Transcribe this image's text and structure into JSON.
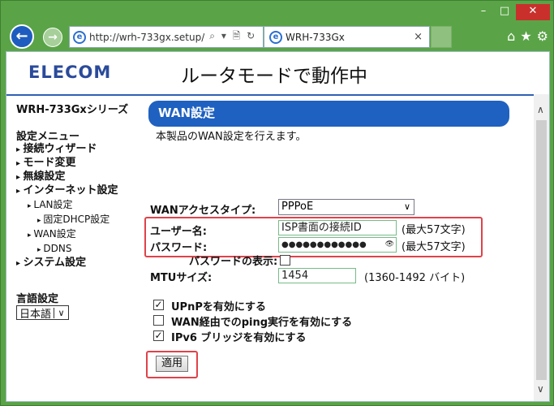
{
  "window": {
    "controls": {
      "minimize": "–",
      "maximize": "□",
      "close": "✕"
    }
  },
  "browser": {
    "url": "http://wrh-733gx.setup/",
    "addr_tools": "⌕ ▾ 🗎 ↻",
    "tab_title": "WRH-733Gx",
    "tab_close": "×",
    "tools": [
      "⌂",
      "★",
      "⚙"
    ]
  },
  "header": {
    "logo": "ELECOM",
    "mode_title": "ルータモードで動作中"
  },
  "sidebar": {
    "series": "WRH-733Gxシリーズ",
    "menu_heading": "設定メニュー",
    "items": [
      {
        "label": "接続ウィザード",
        "level": 1
      },
      {
        "label": "モード変更",
        "level": 1
      },
      {
        "label": "無線設定",
        "level": 1
      },
      {
        "label": "インターネット設定",
        "level": 1
      },
      {
        "label": "LAN設定",
        "level": 2
      },
      {
        "label": "固定DHCP設定",
        "level": 3
      },
      {
        "label": "WAN設定",
        "level": 2
      },
      {
        "label": "DDNS",
        "level": 3
      },
      {
        "label": "システム設定",
        "level": 1
      }
    ],
    "lang_heading": "言語設定",
    "lang_value": "日本語",
    "lang_arrow": "∨"
  },
  "main": {
    "title": "WAN設定",
    "description": "本製品のWAN設定を行えます。",
    "access_type_label": "WANアクセスタイプ:",
    "access_type_value": "PPPoE",
    "access_type_arrow": "∨",
    "username_label": "ユーザー名:",
    "username_value": "ISP書面の接続ID",
    "username_hint": "(最大57文字)",
    "password_label": "パスワード:",
    "password_value": "●●●●●●●●●●●●",
    "password_reveal_icon": "👁",
    "password_hint": "(最大57文字)",
    "show_password_label": "パスワードの表示:",
    "mtu_label": "MTUサイズ:",
    "mtu_value": "1454",
    "mtu_hint": "(1360-1492 バイト)",
    "options": [
      {
        "label": "UPnPを有効にする",
        "checked": true
      },
      {
        "label": "WAN経由でのping実行を有効にする",
        "checked": false
      },
      {
        "label": "IPv6 ブリッジを有効にする",
        "checked": true
      }
    ],
    "apply_label": "適用"
  },
  "scrollbar": {
    "up": "∧",
    "down": "∨"
  },
  "colors": {
    "frame": "#5aa447",
    "accent": "#1f61c0",
    "highlight": "#e0424a"
  }
}
